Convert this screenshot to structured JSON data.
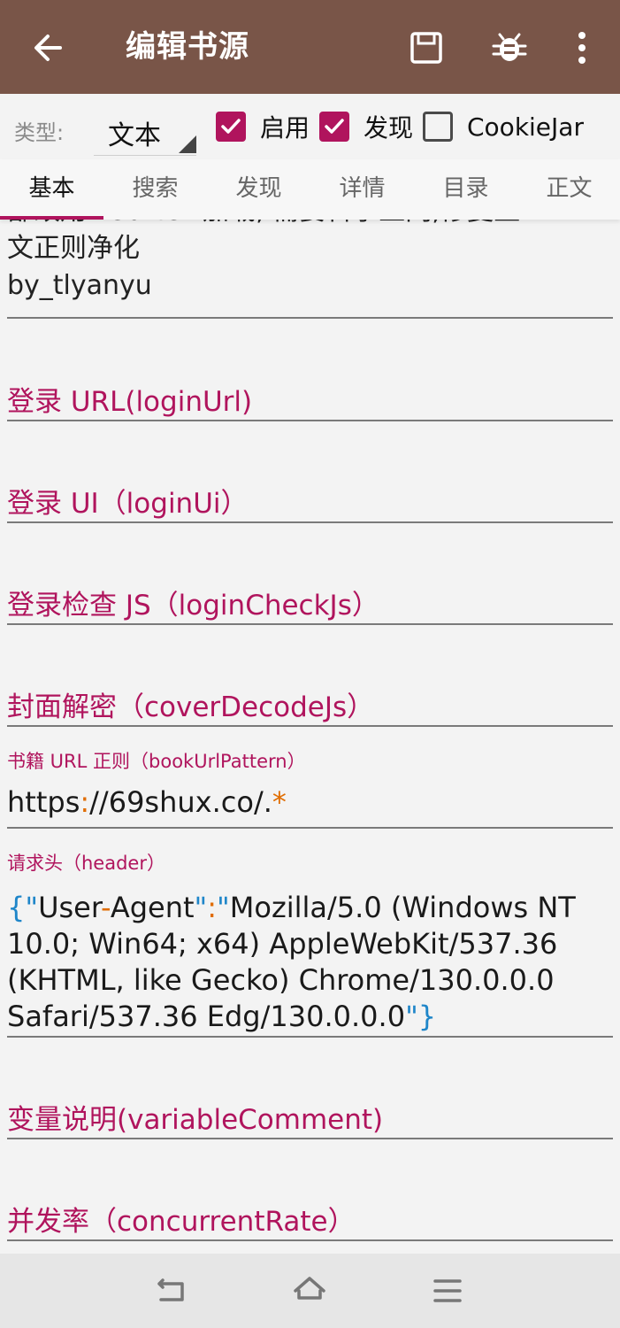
{
  "appbar": {
    "title": "编辑书源"
  },
  "options": {
    "type_label": "类型:",
    "type_value": "文本",
    "enable_label": "启用",
    "discover_label": "发现",
    "cookie_label": "CookieJar",
    "enable_checked": true,
    "discover_checked": true,
    "cookie_checked": false
  },
  "tabs": [
    "基本",
    "搜索",
    "发现",
    "详情",
    "目录",
    "正文"
  ],
  "content": {
    "comment_line1": "部改用webview加载, 需要科学上网;修复正",
    "comment_line2": "文正则净化",
    "comment_line3": "by_tlyanyu",
    "login_url_hint": "登录 URL(loginUrl)",
    "login_ui_hint": "登录 UI（loginUi）",
    "login_check_hint": "登录检查 JS（loginCheckJs）",
    "cover_decode_hint": "封面解密（coverDecodeJs）",
    "book_url_pattern_label": "书籍 URL 正则（bookUrlPattern）",
    "book_url_pattern_value": {
      "part1": "https",
      "part2": ":",
      "part3": "//69shux.co/.",
      "part4": "*"
    },
    "header_label": "请求头（header）",
    "header_value": {
      "l1_open": "{",
      "l1_q1": "\"",
      "l1_key_a": "User",
      "l1_dash": "-",
      "l1_key_b": "Agent",
      "l1_q2": "\"",
      "l1_colon": ":",
      "l1_q3": "\"",
      "l1_val": "Mozilla/5.0 (Windows NT",
      "l2": "10.0; Win64; x64) AppleWebKit/537.36",
      "l3": "(KHTML, like Gecko) Chrome/130.0.0.0",
      "l4_val": "Safari/537.36 Edg/130.0.0.0",
      "l4_q": "\"",
      "l4_close": "}"
    },
    "variable_comment_hint": "变量说明(variableComment)",
    "concurrent_rate_hint": "并发率（concurrentRate）"
  },
  "colors": {
    "appbar": "#795548",
    "accent": "#b0145d",
    "json_key_punct": "#1f86c9",
    "json_symbol": "#e06c00"
  }
}
